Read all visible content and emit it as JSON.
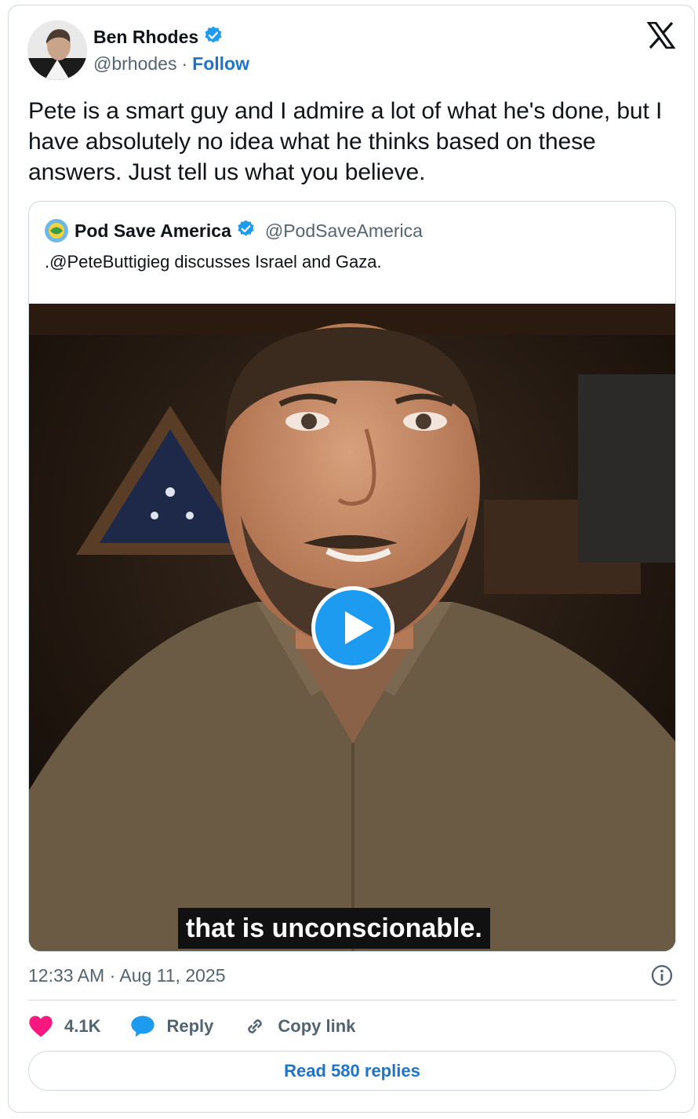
{
  "author": {
    "name": "Ben Rhodes",
    "handle": "@brhodes",
    "separator": "·",
    "follow_label": "Follow",
    "verified": true
  },
  "tweet": {
    "text": "Pete is a smart guy and I admire a lot of what he's done, but I have absolutely no idea what he thinks based on these answers. Just tell us what you believe."
  },
  "quoted": {
    "name": "Pod Save America",
    "handle": "@PodSaveAmerica",
    "verified": true,
    "avatar_text": "POD SAVE AMERICA",
    "text": ".@PeteButtigieg discusses Israel and Gaza.",
    "video_caption": "that is unconscionable."
  },
  "meta": {
    "timestamp": "12:33 AM · Aug 11, 2025"
  },
  "actions": {
    "like_count": "4.1K",
    "reply_label": "Reply",
    "copy_label": "Copy link"
  },
  "footer": {
    "read_replies": "Read 580 replies"
  },
  "colors": {
    "accent": "#1d9bf0",
    "link": "#1d74c9",
    "like": "#f91880",
    "muted": "#536471"
  },
  "icons": {
    "logo": "x-logo-icon",
    "verified": "verified-badge-icon",
    "info": "info-icon",
    "like": "heart-icon",
    "reply": "speech-bubble-icon",
    "copy": "link-icon",
    "play": "play-icon"
  }
}
